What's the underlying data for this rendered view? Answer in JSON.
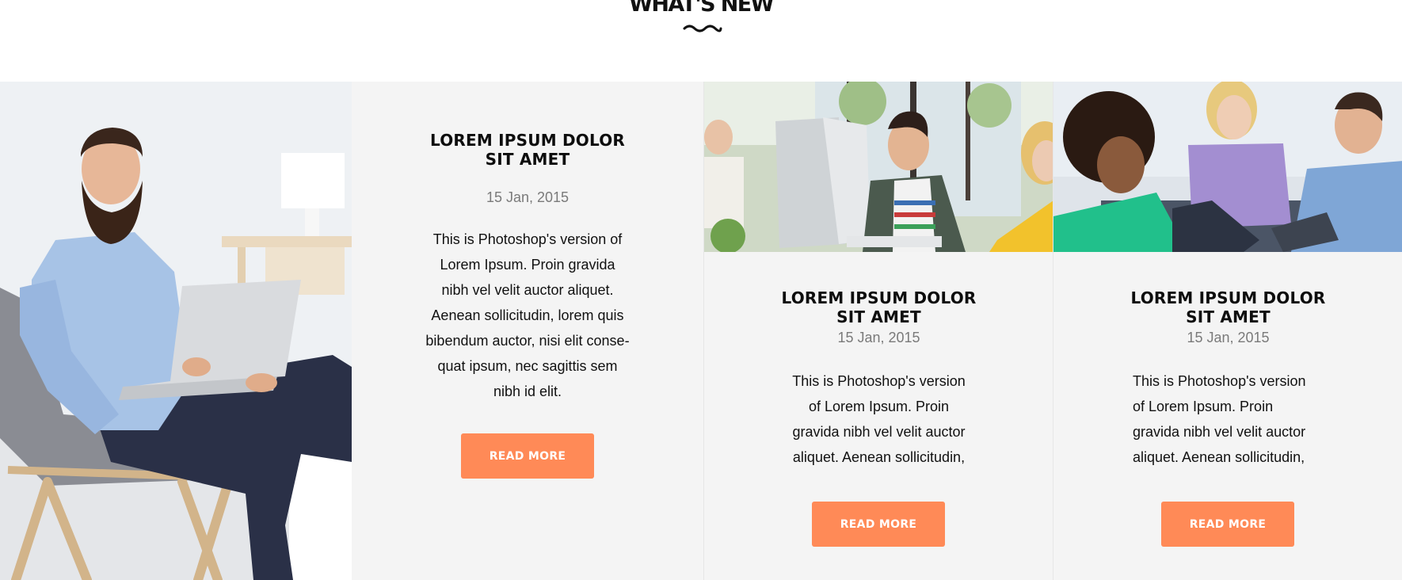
{
  "section": {
    "title": "WHAT'S NEW"
  },
  "posts": [
    {
      "title_line1": "LOREM IPSUM DOLOR",
      "title_line2": "SIT AMET",
      "date": "15 Jan, 2015",
      "excerpt_lines": [
        "This is Photoshop's version  of",
        "Lorem Ipsum. Proin gravida",
        "nibh vel velit auctor aliquet.",
        "Aenean sollicitudin, lorem quis",
        "bibendum auctor, nisi elit conse-",
        "quat ipsum, nec sagittis sem",
        "nibh id elit."
      ],
      "button_label": "READ MORE"
    },
    {
      "title_line1": "LOREM IPSUM DOLOR",
      "title_line2": "SIT AMET",
      "date": "15 Jan, 2015",
      "excerpt_lines": [
        "This is Photoshop's version",
        "of Lorem Ipsum. Proin",
        "gravida nibh vel velit auctor",
        "aliquet. Aenean sollicitudin,"
      ],
      "button_label": "READ MORE"
    },
    {
      "title_line1": "LOREM IPSUM DOLOR",
      "title_line2": "SIT AMET",
      "date": "15 Jan, 2015",
      "excerpt_lines": [
        "This is Photoshop's version",
        "of Lorem Ipsum. Proin",
        "gravida nibh vel velit auctor",
        "aliquet. Aenean sollicitudin,"
      ],
      "button_label": "READ MORE"
    }
  ],
  "icons": {
    "divider": "wave-divider-icon"
  },
  "colors": {
    "accent": "#ff8a57",
    "card_background": "#f4f4f4",
    "title_text": "#0d0d0d",
    "date_text": "#7a7a7a"
  }
}
